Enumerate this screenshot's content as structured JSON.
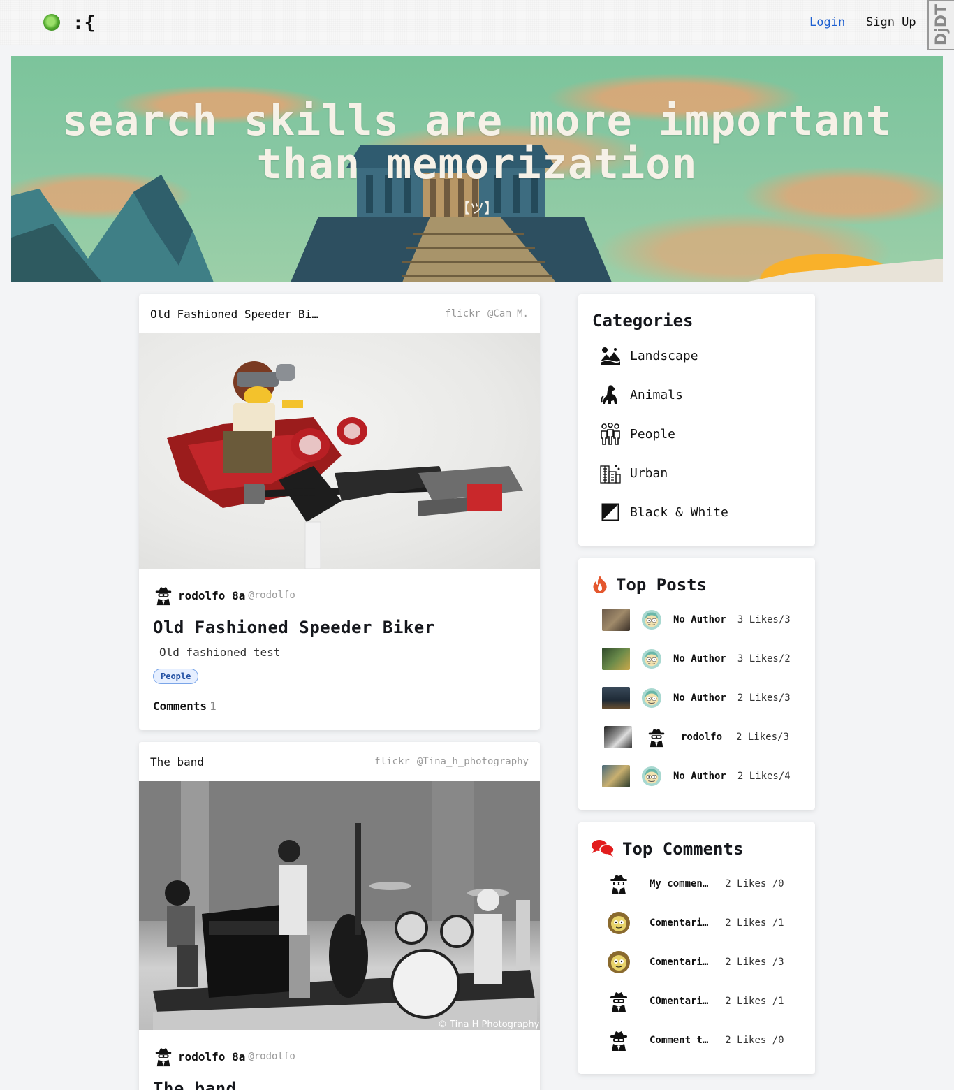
{
  "nav": {
    "logo_text": ":{",
    "login_label": "Login",
    "signup_label": "Sign Up",
    "debug_toolbar_label": "DjDT",
    "login_color": "#1d5fd1"
  },
  "hero": {
    "title_line1": "search skills are more important",
    "title_line2": "than memorization",
    "subtitle": "【ツ】"
  },
  "posts": [
    {
      "header_title": "Old Fashioned Speeder Bi…",
      "source": "flickr",
      "credit": "@Cam M.",
      "author_name": "rodolfo 8a",
      "author_handle": "@rodolfo",
      "title": "Old Fashioned Speeder Biker",
      "description": "Old fashioned test",
      "tag": "People",
      "comments_label": "Comments",
      "comments_count": "1"
    },
    {
      "header_title": "The band",
      "source": "flickr",
      "credit": "@Tina_h_photography",
      "image_watermark": "© Tina H Photography",
      "author_name": "rodolfo 8a",
      "author_handle": "@rodolfo",
      "title": "The band"
    }
  ],
  "categories": {
    "title": "Categories",
    "items": [
      {
        "label": "Landscape",
        "icon": "landscape-icon"
      },
      {
        "label": "Animals",
        "icon": "dog-icon"
      },
      {
        "label": "People",
        "icon": "people-icon"
      },
      {
        "label": "Urban",
        "icon": "city-icon"
      },
      {
        "label": "Black & White",
        "icon": "contrast-icon"
      }
    ]
  },
  "top_posts": {
    "title": "Top Posts",
    "icon": "fire-icon",
    "items": [
      {
        "author": "No Author",
        "likes": "3 Likes/3"
      },
      {
        "author": "No Author",
        "likes": "3 Likes/2"
      },
      {
        "author": "No Author",
        "likes": "2 Likes/3"
      },
      {
        "author": "rodolfo",
        "likes": "2 Likes/3"
      },
      {
        "author": "No Author",
        "likes": "2 Likes/4"
      }
    ]
  },
  "top_comments": {
    "title": "Top Comments",
    "icon": "speech-bubbles-icon",
    "items": [
      {
        "text": "My commen…",
        "likes": "2 Likes /0",
        "avatar": "spy"
      },
      {
        "text": "Comentari…",
        "likes": "2 Likes /1",
        "avatar": "face"
      },
      {
        "text": "Comentari…",
        "likes": "2 Likes /3",
        "avatar": "face"
      },
      {
        "text": "COmentari…",
        "likes": "2 Likes /1",
        "avatar": "spy"
      },
      {
        "text": "Comment t…",
        "likes": "2 Likes /0",
        "avatar": "spy"
      }
    ]
  }
}
